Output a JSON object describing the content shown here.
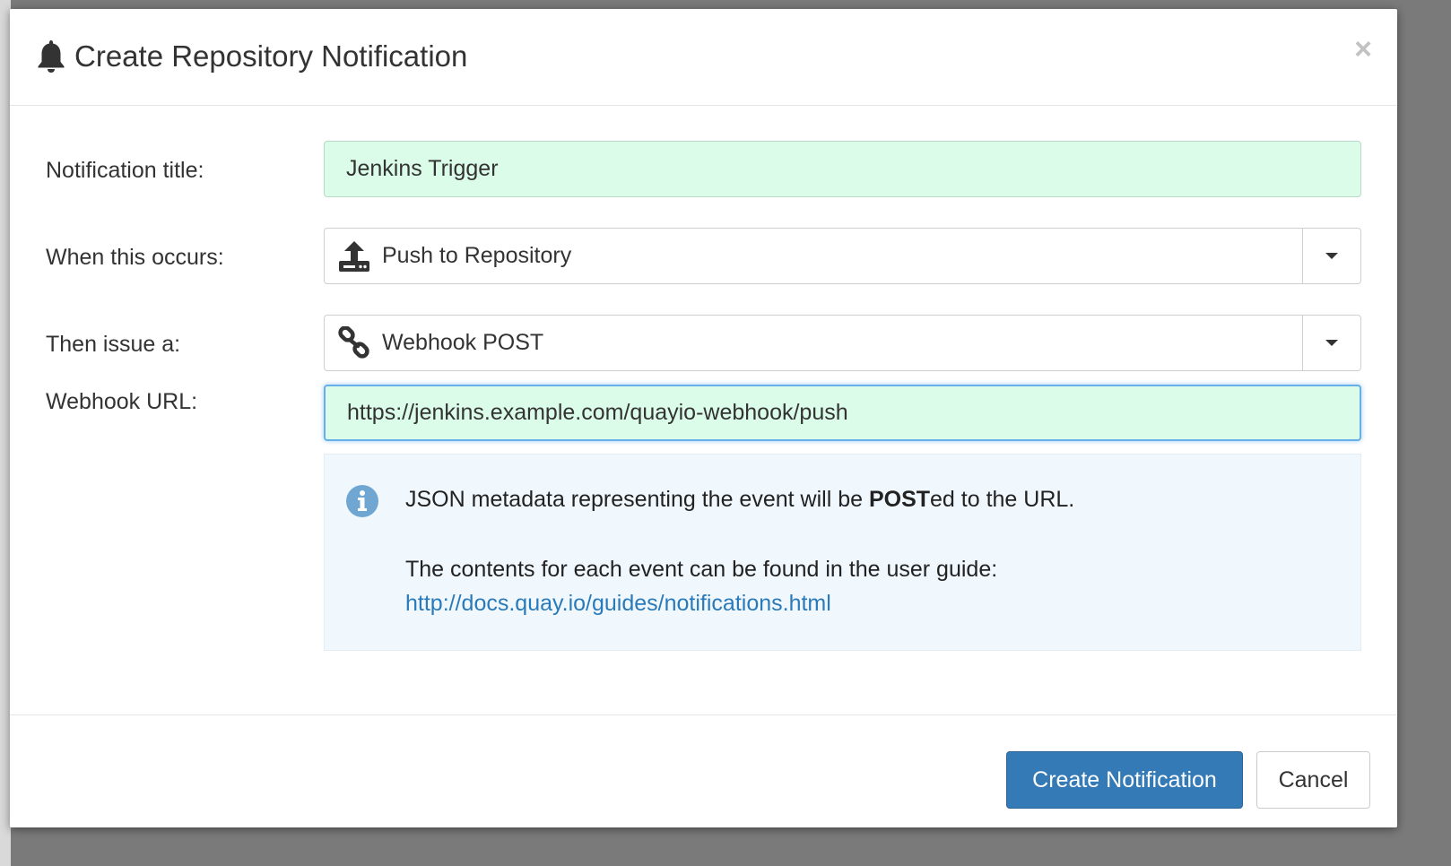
{
  "modal": {
    "title": "Create Repository Notification",
    "title_icon": "bell-icon",
    "close_glyph": "×"
  },
  "form": {
    "notification_title": {
      "label": "Notification title:",
      "value": "Jenkins Trigger"
    },
    "event": {
      "label": "When this occurs:",
      "selected": "Push to Repository",
      "icon": "upload-icon"
    },
    "method": {
      "label": "Then issue a:",
      "selected": "Webhook POST",
      "icon": "link-icon"
    },
    "webhook_url": {
      "label": "Webhook URL:",
      "value": "https://jenkins.example.com/quayio-webhook/push"
    }
  },
  "info": {
    "icon": "info-icon",
    "line1_before": "JSON metadata representing the event will be ",
    "line1_bold": "POST",
    "line1_after": "ed to the URL.",
    "line2": "The contents for each event can be found in the user guide:",
    "link": "http://docs.quay.io/guides/notifications.html"
  },
  "footer": {
    "create_label": "Create Notification",
    "cancel_label": "Cancel"
  },
  "colors": {
    "primary": "#337ab7",
    "filled_input_bg": "#dcfcea",
    "info_bg": "#f0f8fe",
    "link": "#2a7ab9"
  }
}
